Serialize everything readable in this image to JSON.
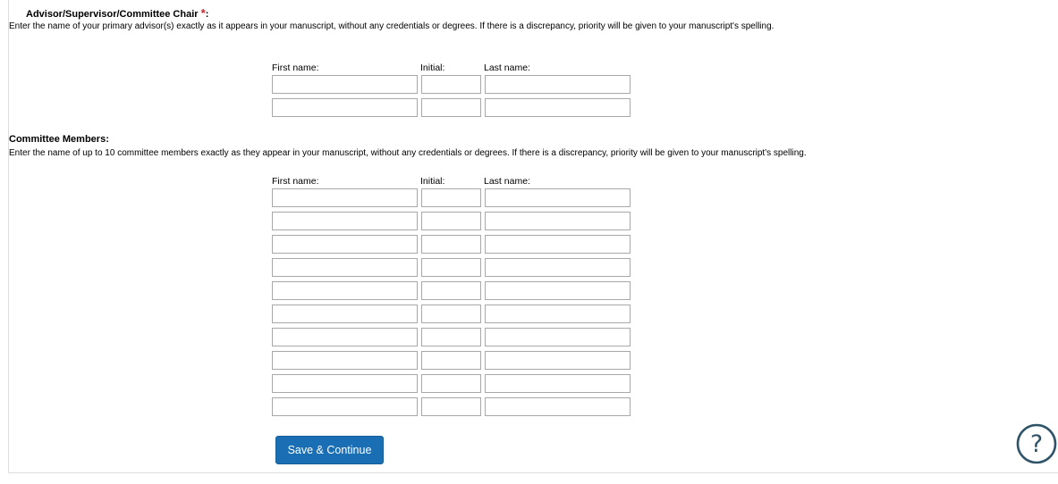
{
  "advisor": {
    "title": "Advisor/Supervisor/Committee Chair",
    "required_mark": "*",
    "title_suffix": ":",
    "instructions": "Enter the name of your primary advisor(s) exactly as it appears in your manuscript, without any credentials or degrees. If there is a discrepancy, priority will be given to your manuscript's spelling.",
    "headers": {
      "first": "First name:",
      "initial": "Initial:",
      "last": "Last name:"
    },
    "rows": [
      {
        "first": "",
        "initial": "",
        "last": ""
      },
      {
        "first": "",
        "initial": "",
        "last": ""
      }
    ]
  },
  "committee": {
    "title": "Committee Members:",
    "instructions": "Enter the name of up to 10 committee members exactly as they appear in your manuscript, without any credentials or degrees. If there is a discrepancy, priority will be given to your manuscript's spelling.",
    "headers": {
      "first": "First name:",
      "initial": "Initial:",
      "last": "Last name:"
    },
    "rows": [
      {
        "first": "",
        "initial": "",
        "last": ""
      },
      {
        "first": "",
        "initial": "",
        "last": ""
      },
      {
        "first": "",
        "initial": "",
        "last": ""
      },
      {
        "first": "",
        "initial": "",
        "last": ""
      },
      {
        "first": "",
        "initial": "",
        "last": ""
      },
      {
        "first": "",
        "initial": "",
        "last": ""
      },
      {
        "first": "",
        "initial": "",
        "last": ""
      },
      {
        "first": "",
        "initial": "",
        "last": ""
      },
      {
        "first": "",
        "initial": "",
        "last": ""
      },
      {
        "first": "",
        "initial": "",
        "last": ""
      }
    ]
  },
  "actions": {
    "save_label": "Save & Continue"
  },
  "help": {
    "icon": "help-circle-icon",
    "glyph": "?"
  },
  "colors": {
    "primary_button": "#1a6fb4",
    "required": "#c4262e",
    "help_icon": "#2f5368"
  }
}
